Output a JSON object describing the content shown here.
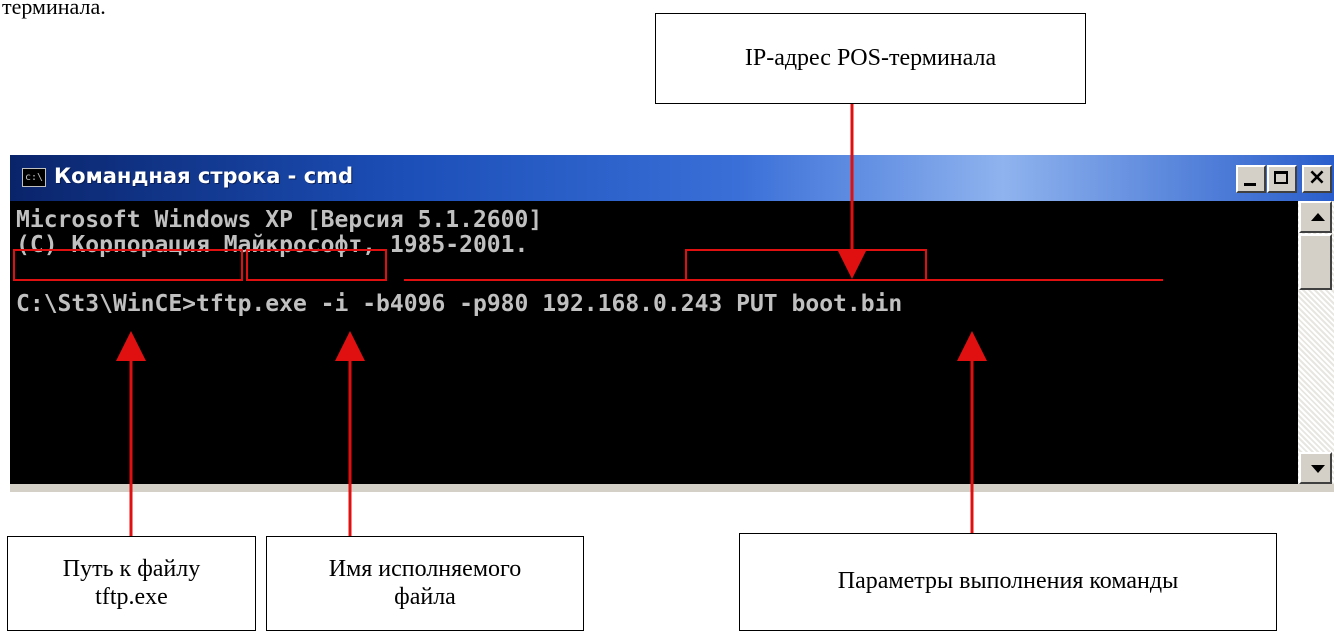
{
  "top_text": "терминала.",
  "callouts": {
    "ip": "IP-адрес POS-терминала",
    "path": "Путь к файлу\ntftp.exe",
    "exe": "Имя исполняемого\nфайла",
    "params": "Параметры выполнения команды"
  },
  "window": {
    "title": "Командная строка - cmd",
    "icon_label": "c:\\",
    "buttons": {
      "close": "×"
    }
  },
  "console": {
    "line1": "Microsoft Windows XP [Версия 5.1.2600]",
    "line2": "(С) Корпорация Майкрософт, 1985-2001.",
    "prompt": "C:\\St3\\WinCE",
    "prompt_sep": ">",
    "exe": "tftp.exe",
    "gap1": " ",
    "options": "-i -b4096 -p980",
    "gap2": " ",
    "ip": "192.168.0.243",
    "tail": " PUT boot.bin"
  },
  "colors": {
    "annotation": "#e01010",
    "console_bg": "#000000",
    "console_fg": "#c0c0c0"
  },
  "icons": [
    "console-app-icon",
    "minimize-icon",
    "maximize-icon",
    "close-icon",
    "scroll-up-icon",
    "scroll-down-icon"
  ]
}
